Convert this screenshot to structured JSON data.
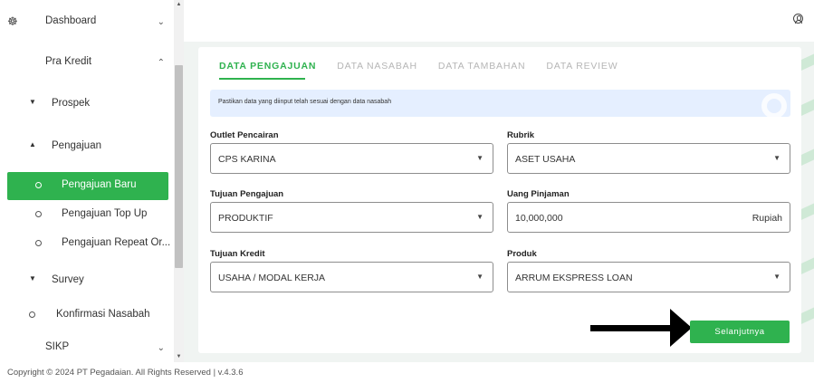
{
  "sidebar": {
    "items": [
      {
        "label": "Dashboard"
      },
      {
        "label": "Pra Kredit"
      },
      {
        "label": "Prospek"
      },
      {
        "label": "Pengajuan"
      },
      {
        "label": "Pengajuan Baru"
      },
      {
        "label": "Pengajuan Top Up"
      },
      {
        "label": "Pengajuan Repeat Or..."
      },
      {
        "label": "Survey"
      },
      {
        "label": "Konfirmasi Nasabah"
      },
      {
        "label": "SIKP"
      }
    ],
    "active_item": "Pengajuan Baru",
    "icons": {
      "dashboard": "gauge-icon",
      "expand": "chevron-down-icon",
      "collapse": "chevron-up-icon"
    }
  },
  "header": {
    "user_icon": "user-circle-icon"
  },
  "tabs": [
    {
      "label": "DATA PENGAJUAN"
    },
    {
      "label": "DATA NASABAH"
    },
    {
      "label": "DATA TAMBAHAN"
    },
    {
      "label": "DATA REVIEW"
    }
  ],
  "info": {
    "text": "Pastikan data yang diinput telah sesuai dengan data nasabah"
  },
  "form": {
    "outlet_pencairan": {
      "label": "Outlet Pencairan",
      "value": "CPS KARINA"
    },
    "rubrik": {
      "label": "Rubrik",
      "value": "ASET USAHA"
    },
    "tujuan_pengajuan": {
      "label": "Tujuan Pengajuan",
      "value": "PRODUKTIF"
    },
    "uang_pinjaman": {
      "label": "Uang Pinjaman",
      "value": "10,000,000",
      "suffix": "Rupiah"
    },
    "tujuan_kredit": {
      "label": "Tujuan Kredit",
      "value": "USAHA / MODAL KERJA"
    },
    "produk": {
      "label": "Produk",
      "value": "ARRUM EKSPRESS LOAN"
    }
  },
  "actions": {
    "next_label": "Selanjutnya"
  },
  "footer": {
    "copyright": "Copyright © 2024 PT Pegadaian. All Rights Reserved | v.4.3.6"
  },
  "colors": {
    "accent": "#2fb24f",
    "info_bg": "#e5efff",
    "main_bg": "#f0f4f2"
  }
}
